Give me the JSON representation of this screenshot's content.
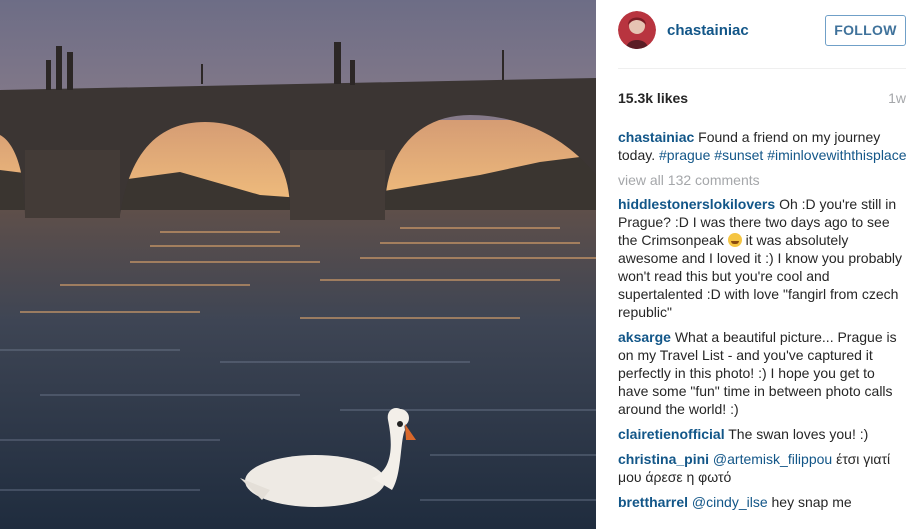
{
  "post": {
    "username": "chastainiac",
    "follow_label": "FOLLOW",
    "likes": "15.3k likes",
    "age": "1w",
    "caption_text": "Found a friend on my journey today.",
    "caption_tags": [
      "#prague",
      "#sunset",
      "#iminlovewiththisplace"
    ],
    "view_all": "view all 132 comments"
  },
  "comments": [
    {
      "user": "hiddlestonerslokilovers",
      "text_before_emoji": "Oh :D you're still in Prague? :D I was there two days ago to see the Crimsonpeak",
      "emoji": "crying-laughing-emoji",
      "text_after_emoji": "it was absolutely awesome and I loved it :) I know you probably won't read this but you're cool and supertalented :D with love \"fangirl from czech republic\""
    },
    {
      "user": "aksarge",
      "text": "What a beautiful picture... Prague is on my Travel List - and you've captured it perfectly in this photo! :) I hope you get to have some \"fun\" time in between photo calls around the world! :)"
    },
    {
      "user": "clairetienofficial",
      "text": "The swan loves you! :)"
    },
    {
      "user": "christina_pini",
      "mention": "@artemisk_filippou",
      "text": "έτσι γιατί μου άρεσε η φωτό"
    },
    {
      "user": "brettharrel",
      "mention": "@cindy_ilse",
      "text": "hey snap me"
    }
  ],
  "colors": {
    "link": "#125688",
    "muted": "#a5a7aa",
    "follow_border": "#70a0c8"
  }
}
